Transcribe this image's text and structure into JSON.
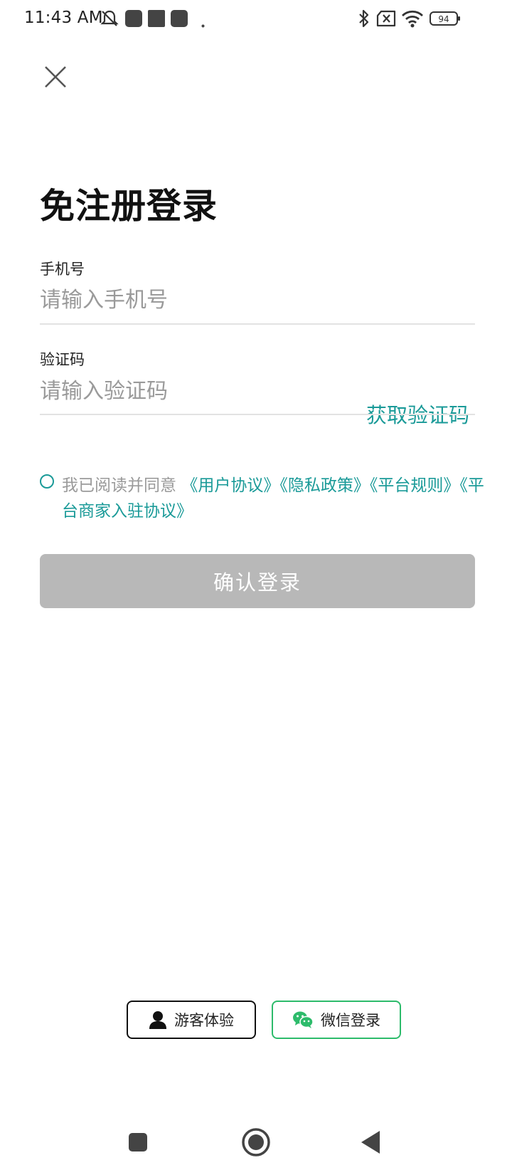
{
  "status_bar": {
    "time": "11:43 AM",
    "battery": "94",
    "icons": [
      "mute-icon",
      "app-icon",
      "app-icon",
      "app-icon",
      "dot-icon",
      "bluetooth-icon",
      "no-sim-icon",
      "wifi-icon",
      "battery-icon"
    ]
  },
  "header": {
    "close_icon": "close-icon"
  },
  "title": "免注册登录",
  "phone": {
    "label": "手机号",
    "placeholder": "请输入手机号",
    "value": ""
  },
  "code": {
    "label": "验证码",
    "placeholder": "请输入验证码",
    "value": "",
    "get_code_label": "获取验证码"
  },
  "agreement": {
    "prefix": "我已阅读并同意 ",
    "links": [
      "《用户协议》",
      "《隐私政策》",
      "《平台规则》",
      "《平台商家入驻协议》"
    ],
    "checked": false
  },
  "login_button": "确认登录",
  "alt_login": {
    "guest_label": "游客体验",
    "wechat_label": "微信登录"
  },
  "colors": {
    "accent": "#1a9a98",
    "disabled_button": "#b8b8b8",
    "wechat_green": "#2dbb6b"
  },
  "nav_bar": {
    "icons": [
      "recent-apps-icon",
      "home-icon",
      "back-icon"
    ]
  }
}
